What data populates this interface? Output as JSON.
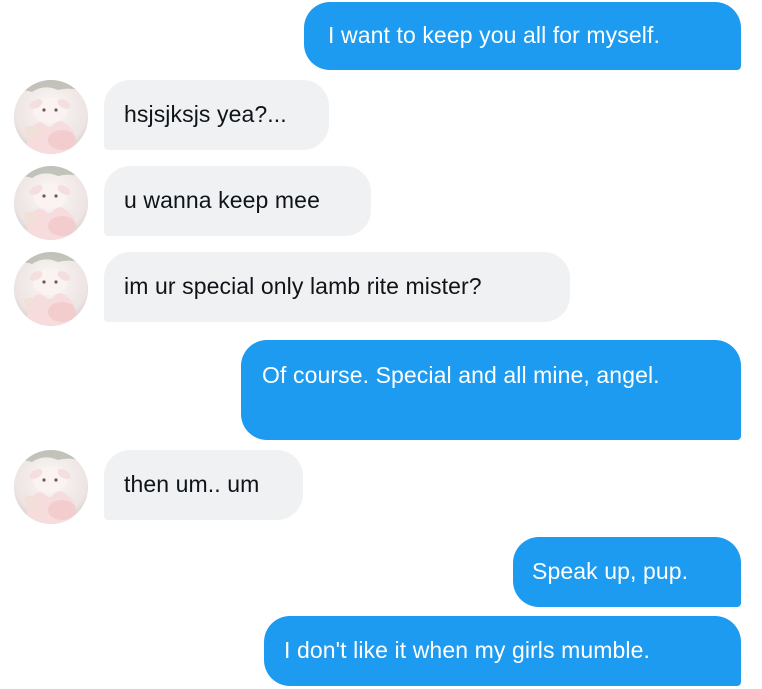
{
  "conversation": {
    "messages": [
      {
        "direction": "outgoing",
        "text": "I want to keep you all for myself."
      },
      {
        "direction": "incoming",
        "text": "hsjsjksjs yea?..."
      },
      {
        "direction": "incoming",
        "text": "u wanna keep mee"
      },
      {
        "direction": "incoming",
        "text": "im ur special only lamb rite mister?"
      },
      {
        "direction": "outgoing",
        "text": "Of course. Special and all mine, angel."
      },
      {
        "direction": "incoming",
        "text": "then um.. um"
      },
      {
        "direction": "outgoing",
        "text": "Speak up, pup."
      },
      {
        "direction": "outgoing",
        "text": "I don't like it when my girls mumble."
      }
    ]
  },
  "colors": {
    "outgoing_bubble": "#1d9bf0",
    "incoming_bubble": "#eff1f3",
    "outgoing_text": "#ffffff",
    "incoming_text": "#0f1419"
  },
  "icons": {
    "contact_avatar": "avatar-photo-icon"
  }
}
